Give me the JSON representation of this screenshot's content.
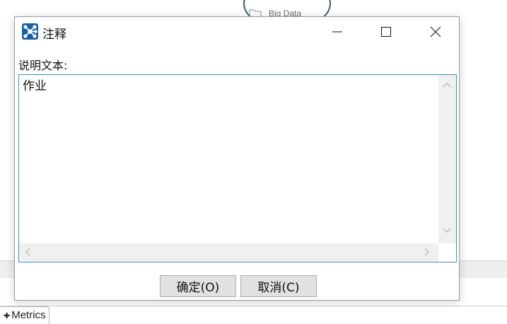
{
  "background": {
    "node_label": "Big Data",
    "tab_label": "Metrics"
  },
  "dialog": {
    "title": "注释",
    "app_icon": "network-icon",
    "window_controls": {
      "minimize": "minimize-icon",
      "maximize": "maximize-icon",
      "close": "close-icon"
    },
    "field_label": "说明文本:",
    "text_value": "作业",
    "ok_label": "确定(O)",
    "cancel_label": "取消(C)"
  },
  "colors": {
    "accent": "#1560a8",
    "textarea_border": "#3f8fc6",
    "button_bg": "#e1e1e1"
  }
}
